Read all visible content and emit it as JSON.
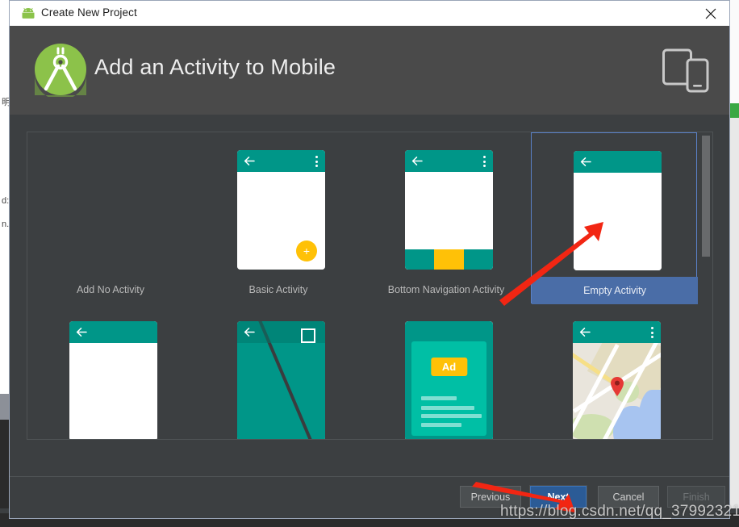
{
  "window": {
    "title": "Create New Project",
    "android_icon": "android-robot-icon",
    "close_icon": "close-icon"
  },
  "header": {
    "title": "Add an Activity to Mobile",
    "logo": "android-studio-logo",
    "device_icon": "tablet-phone-icon"
  },
  "gallery": {
    "items": [
      {
        "label": "Add No Activity",
        "thumb": "none",
        "selected": false
      },
      {
        "label": "Basic Activity",
        "thumb": "basic",
        "selected": false
      },
      {
        "label": "Bottom Navigation Activity",
        "thumb": "bottomnav",
        "selected": false
      },
      {
        "label": "Empty Activity",
        "thumb": "empty",
        "selected": true
      },
      {
        "label": "",
        "thumb": "whitecard",
        "selected": false
      },
      {
        "label": "",
        "thumb": "fullscreen",
        "selected": false
      },
      {
        "label": "",
        "thumb": "ads",
        "selected": false
      },
      {
        "label": "",
        "thumb": "maps",
        "selected": false
      }
    ],
    "ad_badge": "Ad",
    "fab_glyph": "+"
  },
  "footer": {
    "previous": {
      "pre": "P",
      "mnemonic": "",
      "rest": "revious",
      "label": "Previous"
    },
    "next": {
      "label": "Next",
      "mnemonic": "N",
      "rest": "ext"
    },
    "cancel": {
      "label": "Cancel",
      "mnemonic": "C",
      "rest": "ancel"
    },
    "finish": {
      "label": "Finish",
      "mnemonic": "F",
      "rest": "inish",
      "disabled": true
    }
  },
  "watermark": "https://blog.csdn.net/qq_37992321",
  "background": {
    "prompt": ">",
    "glyphs": [
      "明",
      "d:",
      "n."
    ]
  },
  "colors": {
    "dialog_bg": "#3c3f41",
    "header_bg": "#4a4a4a",
    "accent_teal": "#009688",
    "accent_yellow": "#ffc107",
    "selection_blue": "#4a6da7",
    "primary_button": "#2b5b96",
    "annotation_red": "#f22613"
  }
}
